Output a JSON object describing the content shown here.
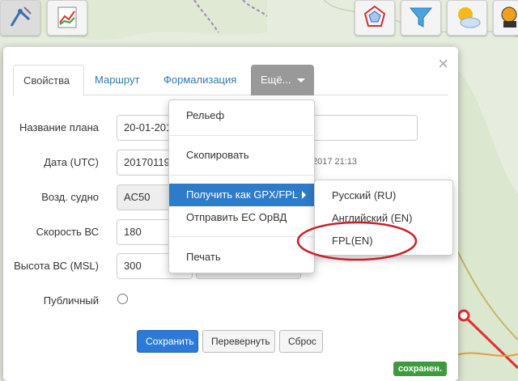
{
  "dialog": {
    "close": "×",
    "tabs": [
      {
        "label": "Свойства"
      },
      {
        "label": "Маршрут"
      },
      {
        "label": "Формализация"
      },
      {
        "label": "Ещё..."
      }
    ],
    "fields": {
      "plan_name": {
        "label": "Название плана",
        "value": "20-01-201"
      },
      "date": {
        "label": "Дата (UTC)",
        "value": "20170119",
        "hint": "2017 21:13"
      },
      "aircraft": {
        "label": "Возд. судно",
        "value": "AC50"
      },
      "speed": {
        "label": "Скорость ВС",
        "value": "180"
      },
      "altitude": {
        "label": "Высота ВС (MSL)",
        "value": "300"
      },
      "public": {
        "label": "Публичный"
      }
    },
    "buttons": {
      "save": "Сохранить",
      "reverse": "Перевернуть",
      "reset": "Сброс"
    },
    "status": "сохранен."
  },
  "dropdown": {
    "items": [
      {
        "label": "Рельеф"
      },
      {
        "label": "Скопировать"
      },
      {
        "label": "Получить как GPX/FPL"
      },
      {
        "label": "Отправить ЕС ОрВД"
      },
      {
        "label": "Печать"
      }
    ]
  },
  "submenu": {
    "items": [
      {
        "label": "Русский (RU)"
      },
      {
        "label": "Английский (EN)"
      },
      {
        "label": "FPL(EN)"
      }
    ]
  },
  "toolbar": {
    "icons": [
      "route-tool-icon",
      "chart-report-icon",
      "radar-icon",
      "filter-icon",
      "weather-icon",
      "profile-icon"
    ]
  },
  "colors": {
    "accent": "#2e7bc9",
    "primary_button": "#2d7ad6",
    "saved_badge": "#3f9a3f",
    "annotation": "#c8202a"
  }
}
